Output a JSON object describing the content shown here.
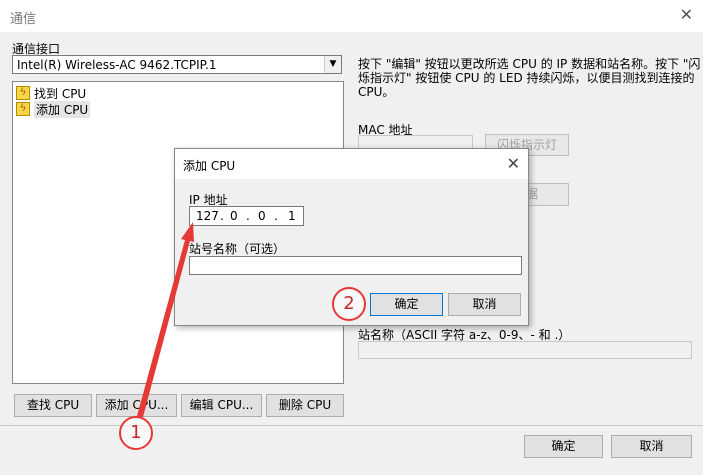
{
  "window": {
    "title": "通信",
    "close_glyph": "✕"
  },
  "interface": {
    "label": "通信接口",
    "selected": "Intel(R) Wireless-AC 9462.TCPIP.1"
  },
  "list": {
    "items": [
      {
        "label": "找到 CPU",
        "icon": "bolt-icon"
      },
      {
        "label": "添加 CPU",
        "icon": "bolt-icon",
        "selected": true
      }
    ]
  },
  "info_text": {
    "line1": "按下 \"编辑\" 按钮以更改所选 CPU 的 IP 数据和站名称。按下 \"闪",
    "line2": "烁指示灯\" 按钮使 CPU 的 LED 持续闪烁，以便目测找到连接的",
    "line3": "CPU。"
  },
  "mac": {
    "label": "MAC 地址",
    "value": ""
  },
  "flash_button": "闪烁指示灯",
  "edit_data_button_fragment": "据",
  "station": {
    "label": "站名称（ASCII 字符 a-z、0-9、- 和 .）",
    "value": ""
  },
  "bottom_buttons": {
    "find": "查找 CPU",
    "add": "添加 CPU...",
    "edit": "编辑 CPU...",
    "delete": "删除 CPU"
  },
  "footer": {
    "ok": "确定",
    "cancel": "取消"
  },
  "dialog": {
    "title": "添加 CPU",
    "close_glyph": "✕",
    "ip_label": "IP 地址",
    "ip": {
      "o1": "127",
      "o2": "0",
      "o3": "0",
      "o4": "1"
    },
    "ip_dot": ".",
    "station_label": "站号名称（可选）",
    "station_value": "",
    "ok": "确定",
    "cancel": "取消"
  },
  "annotations": {
    "marker1": "1",
    "marker2": "2",
    "color": "#e53935"
  }
}
